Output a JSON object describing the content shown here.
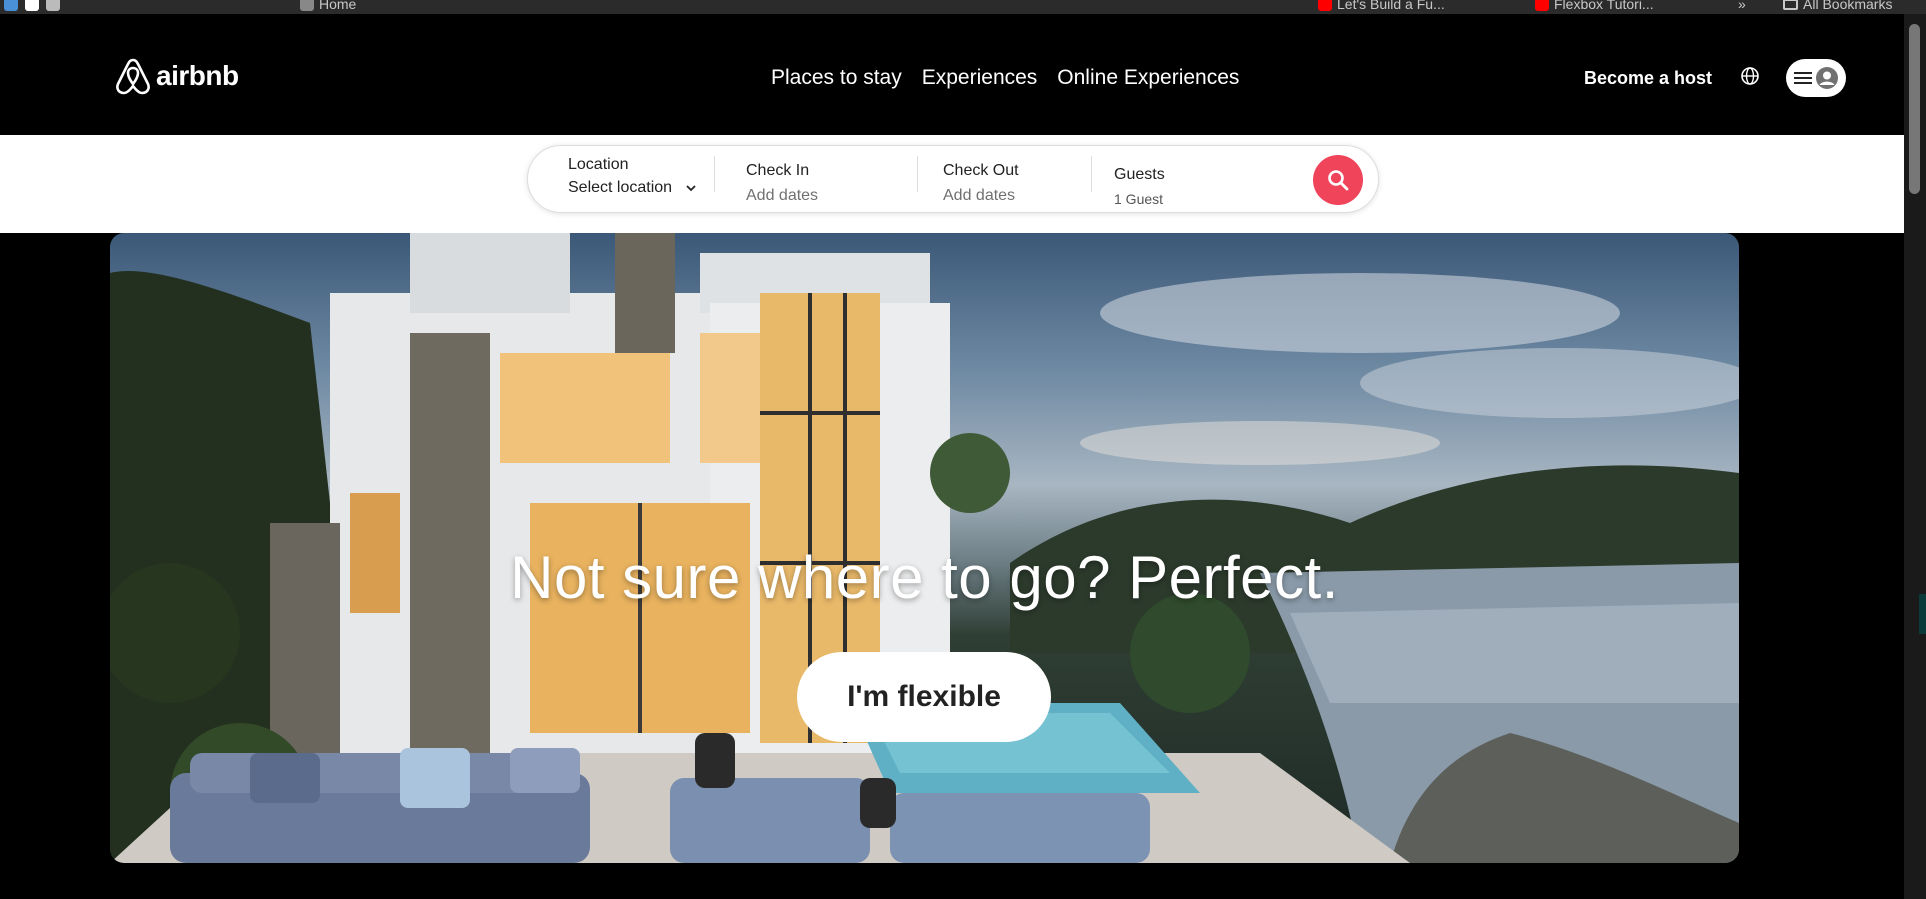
{
  "browser": {
    "bookmarks": [
      {
        "label": "Home",
        "color": "#888888"
      },
      {
        "label": "Let's Build a Fu...",
        "color": "#ff0000"
      },
      {
        "label": "Flexbox Tutori...",
        "color": "#ff0000"
      }
    ],
    "overflow_label": "»",
    "all_bookmarks_label": "All Bookmarks"
  },
  "navbar": {
    "logo_text": "airbnb",
    "links": [
      "Places to stay",
      "Experiences",
      "Online Experiences"
    ],
    "host_label": "Become a host"
  },
  "search": {
    "location_label": "Location",
    "location_value": "Select location",
    "checkin_label": "Check In",
    "checkin_placeholder": "Add dates",
    "checkout_label": "Check Out",
    "checkout_placeholder": "Add dates",
    "guests_label": "Guests",
    "guests_value": "1 Guest"
  },
  "hero": {
    "title": "Not sure where to go? Perfect.",
    "button_label": "I'm flexible"
  },
  "colors": {
    "accent": "#f0445b",
    "navbar_bg": "#000000",
    "text": "#222222"
  }
}
